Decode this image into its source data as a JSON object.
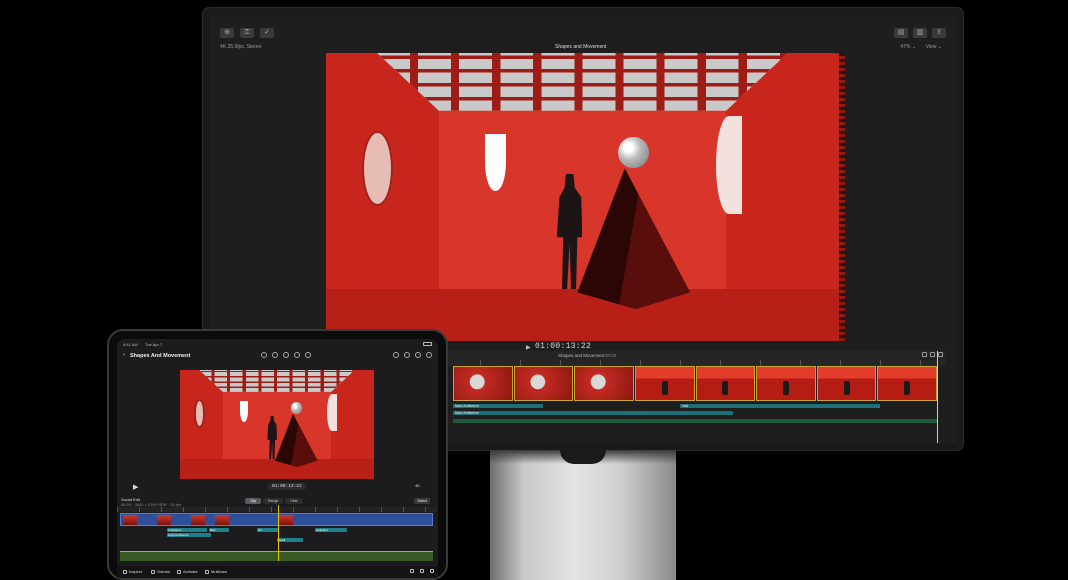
{
  "monitor": {
    "library_label": "4K 25.0fps, Stereo",
    "project_title": "Shapes and Movement",
    "zoom_label": "47% ⌄",
    "view_label": "View ⌄",
    "timecode": "01:00:13:22",
    "timeline_project": "Shapes and Movement",
    "timeline_duration": "00:20",
    "clips": [
      "Main Ambience",
      "Hall",
      "Main Ambience"
    ]
  },
  "ipad": {
    "status_time": "9:41 AM",
    "status_date": "Tue Apr 7",
    "project_title": "Shapes And Movement",
    "timecode": "01:00:13:22",
    "zoom_label": "4K",
    "project_info_title": "Social Edit",
    "project_info_sub": "00:20 · 3840 × 2160 HDR · 24 fps",
    "segments": [
      "Clip",
      "Range",
      "Hide"
    ],
    "select_label": "Select",
    "chips": [
      "Ambiance",
      "Bed",
      "Light Ambience",
      "Hit",
      "Swell",
      "Highlight"
    ],
    "bottom_buttons": [
      "Inspect",
      "Volume",
      "Animate",
      "Multicam"
    ]
  }
}
